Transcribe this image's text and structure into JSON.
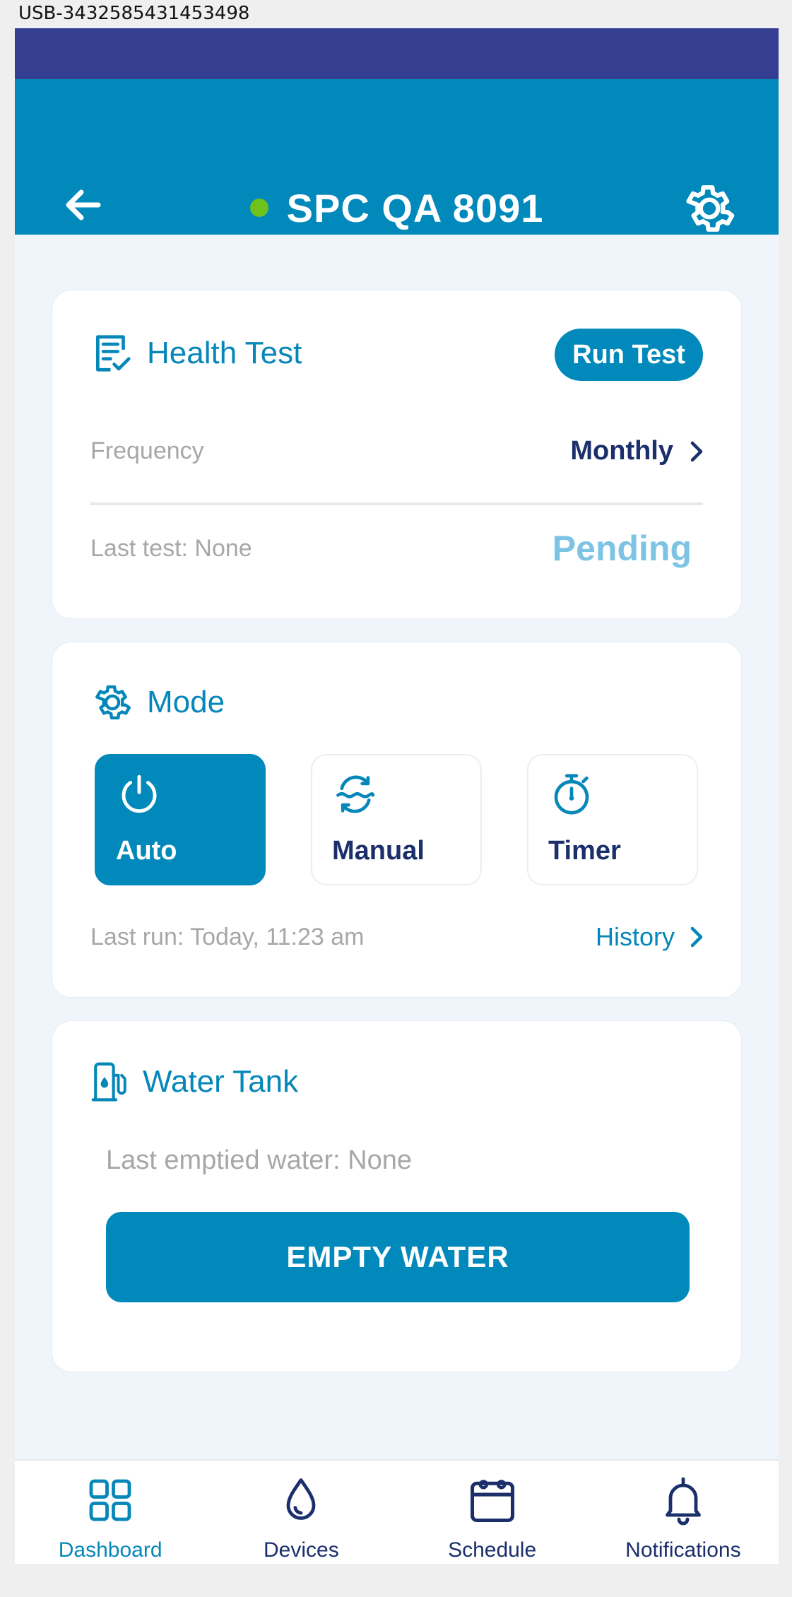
{
  "window": {
    "title": "USB-3432585431453498"
  },
  "header": {
    "title": "SPC QA 8091",
    "status_color": "#6fc21b",
    "back_icon": "arrow-left-icon",
    "settings_icon": "gear-icon"
  },
  "health_test": {
    "title": "Health Test",
    "icon": "checklist-icon",
    "run_button": "Run Test",
    "frequency_label": "Frequency",
    "frequency_value": "Monthly",
    "last_test": "Last test: None",
    "status": "Pending"
  },
  "mode": {
    "title": "Mode",
    "icon": "gear-icon",
    "options": [
      {
        "label": "Auto",
        "icon": "power-icon",
        "selected": true
      },
      {
        "label": "Manual",
        "icon": "water-cycle-icon",
        "selected": false
      },
      {
        "label": "Timer",
        "icon": "stopwatch-icon",
        "selected": false
      }
    ],
    "last_run": "Last run: Today, 11:23 am",
    "history_link": "History"
  },
  "water_tank": {
    "title": "Water Tank",
    "icon": "water-tank-icon",
    "last_emptied": "Last emptied water: None",
    "button": "EMPTY WATER"
  },
  "bottom_nav": [
    {
      "label": "Dashboard",
      "icon": "grid-icon",
      "active": true
    },
    {
      "label": "Devices",
      "icon": "drop-icon",
      "active": false
    },
    {
      "label": "Schedule",
      "icon": "calendar-icon",
      "active": false
    },
    {
      "label": "Notifications",
      "icon": "bell-icon",
      "active": false
    }
  ],
  "colors": {
    "primary": "#0289bb",
    "status_bar": "#353f91",
    "text_dark": "#1b2f6b",
    "muted": "#a7a7a7",
    "pending": "#7dc3e4"
  }
}
